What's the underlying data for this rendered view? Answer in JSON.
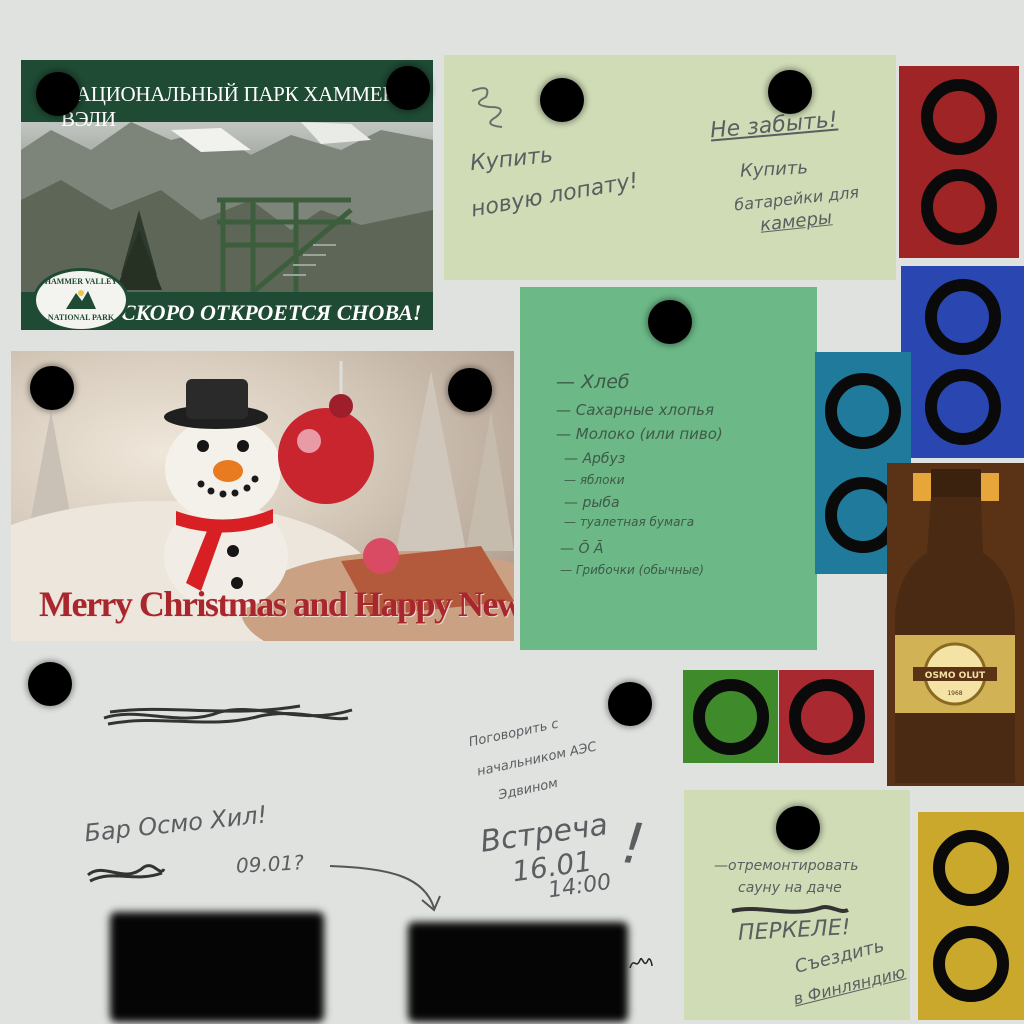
{
  "park_sign": {
    "title": "НАЦИОНАЛЬНЫЙ ПАРК ХАММЕР ВЭЛИ",
    "subtitle": "СКОРО ОТКРОЕТСЯ СНОВА!",
    "logo_line1": "HAMMER VALLEY",
    "logo_line2": "NATIONAL PARK",
    "band_color": "#1f4a33"
  },
  "xmas_card": {
    "caption": "Merry Christmas and Happy New Year",
    "caption_color": "#a8262d"
  },
  "note_shopping": {
    "left_line1": "Купить",
    "left_line2": "новую лопату!",
    "right_title": "Не забыть!",
    "right_line1": "Купить",
    "right_line2": "батарейки для",
    "right_line3": "камеры"
  },
  "note_grocery": {
    "items": [
      "— Хлеб",
      "— Сахарные хлопья",
      "— Молоко (или пиво)",
      "— Арбуз",
      "— яблоки",
      "— рыба",
      "— туалетная бумага",
      "— Ō Ā",
      "— Грибочки (обычные)"
    ]
  },
  "board_notes": {
    "bar": "Бар Осмо Хил!",
    "date_q": "09.01?",
    "talk_line1": "Поговорить с",
    "talk_line2": "начальником АЭС",
    "talk_line3": "Эдвином",
    "meeting_line1": "Встреча",
    "meeting_line2": "16.01",
    "meeting_line3": "14:00",
    "meeting_mark": "!"
  },
  "note_sauna": {
    "line1": "—отремонтировать",
    "line2": "сауну на даче",
    "line4": "ПЕРКЕЛЕ!",
    "line5": "Съездить",
    "line6": "в Финляндию"
  },
  "beer": {
    "brand": "OSMO OLUT",
    "year": "1968",
    "glass_color": "#4a2a12",
    "label_color": "#d8b95a"
  },
  "tiles": {
    "red": "#9e2426",
    "blue": "#2a46b0",
    "teal": "#1f7a9c",
    "green": "#3f8a2a",
    "red2": "#a82a30",
    "yellow": "#c9a82c"
  }
}
